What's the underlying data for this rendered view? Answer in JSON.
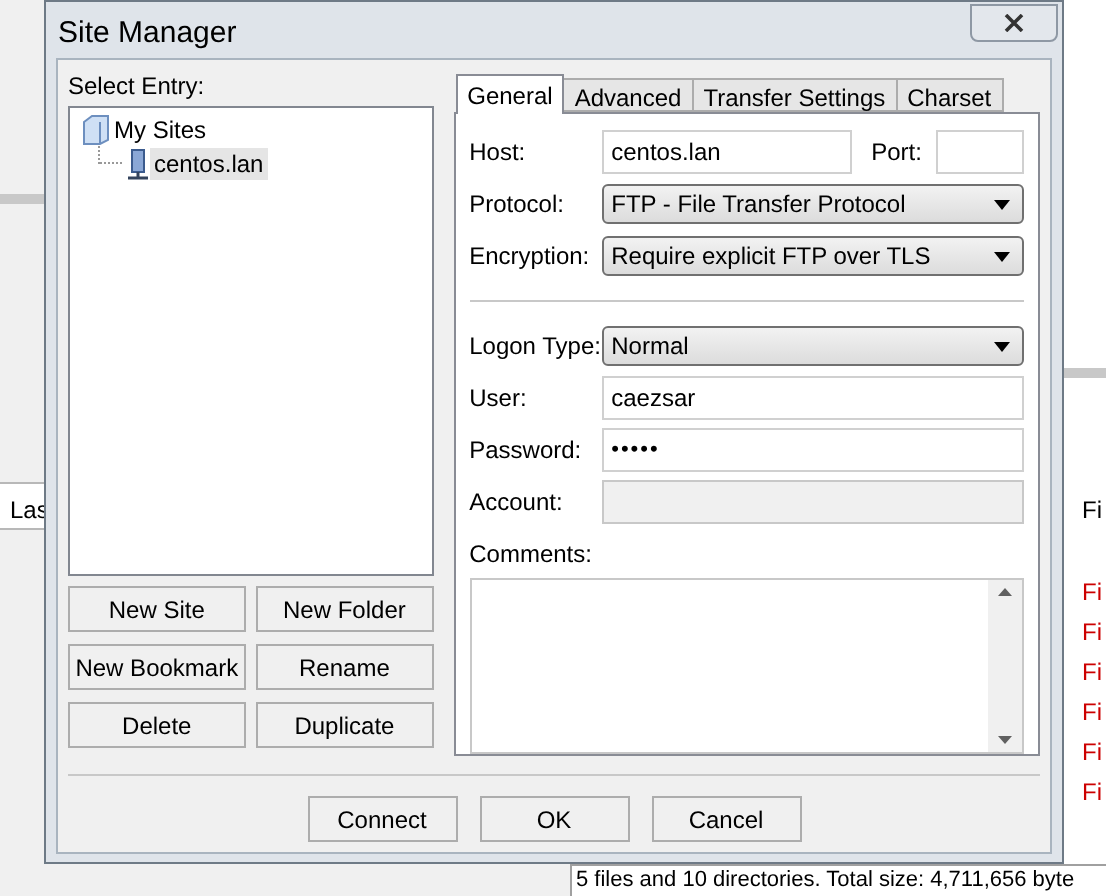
{
  "background_app": {
    "left_header": "Las",
    "right_header": "Fi",
    "right_rows": [
      "Fi",
      "Fi",
      "Fi",
      "Fi",
      "Fi",
      "Fi"
    ],
    "status_text": "5 files and 10 directories. Total size: 4,711,656 byte"
  },
  "dialog": {
    "title": "Site Manager",
    "select_entry_label": "Select Entry:",
    "tree": [
      {
        "label": "My Sites",
        "kind": "folder",
        "selected": false,
        "children": [
          {
            "label": "centos.lan",
            "kind": "site",
            "selected": true
          }
        ]
      }
    ],
    "entry_buttons": [
      "New Site",
      "New Folder",
      "New Bookmark",
      "Rename",
      "Delete",
      "Duplicate"
    ],
    "tabs": [
      {
        "label": "General",
        "selected": true
      },
      {
        "label": "Advanced",
        "selected": false
      },
      {
        "label": "Transfer Settings",
        "selected": false
      },
      {
        "label": "Charset",
        "selected": false
      }
    ],
    "server_fields": [
      {
        "label": "Host:",
        "kind": "text_with_port",
        "value": "centos.lan",
        "port_label": "Port:"
      },
      {
        "label": "Protocol:",
        "kind": "select",
        "value": "FTP - File Transfer Protocol"
      },
      {
        "label": "Encryption:",
        "kind": "select",
        "value": "Require explicit FTP over TLS"
      }
    ],
    "logon_fields": [
      {
        "label": "Logon Type:",
        "kind": "select",
        "value": "Normal"
      },
      {
        "label": "User:",
        "kind": "text",
        "value": "caezsar"
      },
      {
        "label": "Password:",
        "kind": "password",
        "value": "•••••"
      },
      {
        "label": "Account:",
        "kind": "text",
        "disabled": true
      }
    ],
    "comments_label": "Comments:",
    "footer_buttons": [
      "Connect",
      "OK",
      "Cancel"
    ]
  }
}
